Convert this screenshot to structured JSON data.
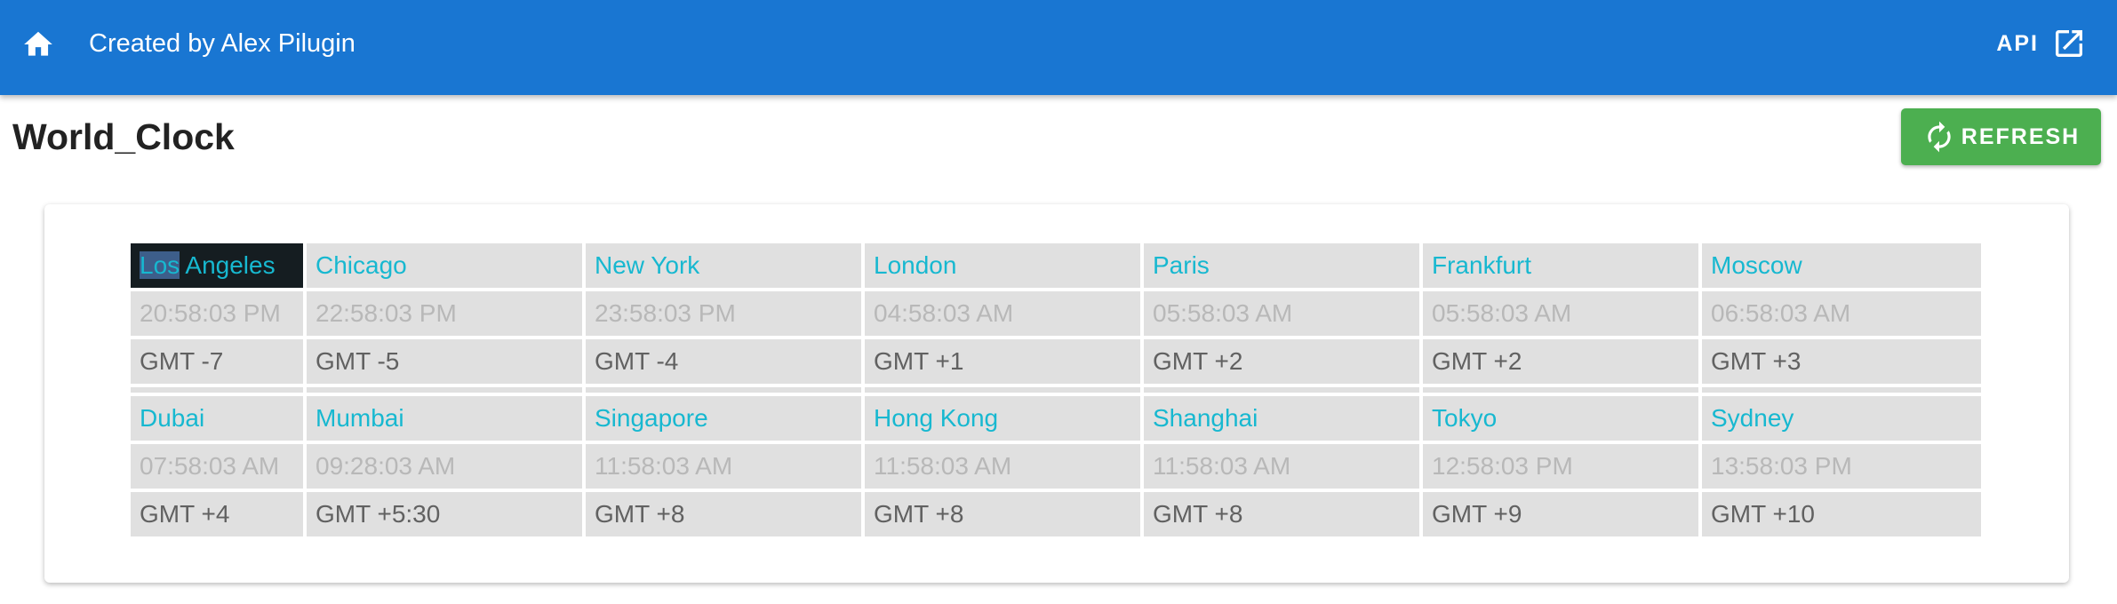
{
  "header": {
    "creator": "Created by Alex Pilugin",
    "api_label": "API",
    "background_color": "#1976d2"
  },
  "page": {
    "title": "World_Clock",
    "refresh_label": "REFRESH",
    "refresh_color": "#4caf50"
  },
  "icons": {
    "home": "home-icon",
    "api": "open-in-new-icon",
    "refresh": "refresh-icon"
  },
  "selection": {
    "city": "Los Angeles",
    "highlighted_text": "Los"
  },
  "clocks": [
    {
      "city": "Los Angeles",
      "time": "20:58:03 PM",
      "gmt": "GMT -7"
    },
    {
      "city": "Chicago",
      "time": "22:58:03 PM",
      "gmt": "GMT -5"
    },
    {
      "city": "New York",
      "time": "23:58:03 PM",
      "gmt": "GMT -4"
    },
    {
      "city": "London",
      "time": "04:58:03 AM",
      "gmt": "GMT +1"
    },
    {
      "city": "Paris",
      "time": "05:58:03 AM",
      "gmt": "GMT +2"
    },
    {
      "city": "Frankfurt",
      "time": "05:58:03 AM",
      "gmt": "GMT +2"
    },
    {
      "city": "Moscow",
      "time": "06:58:03 AM",
      "gmt": "GMT +3"
    },
    {
      "city": "Dubai",
      "time": "07:58:03 AM",
      "gmt": "GMT +4"
    },
    {
      "city": "Mumbai",
      "time": "09:28:03 AM",
      "gmt": "GMT +5:30"
    },
    {
      "city": "Singapore",
      "time": "11:58:03 AM",
      "gmt": "GMT +8"
    },
    {
      "city": "Hong Kong",
      "time": "11:58:03 AM",
      "gmt": "GMT +8"
    },
    {
      "city": "Shanghai",
      "time": "11:58:03 AM",
      "gmt": "GMT +8"
    },
    {
      "city": "Tokyo",
      "time": "12:58:03 PM",
      "gmt": "GMT +9"
    },
    {
      "city": "Sydney",
      "time": "13:58:03 PM",
      "gmt": "GMT +10"
    }
  ]
}
